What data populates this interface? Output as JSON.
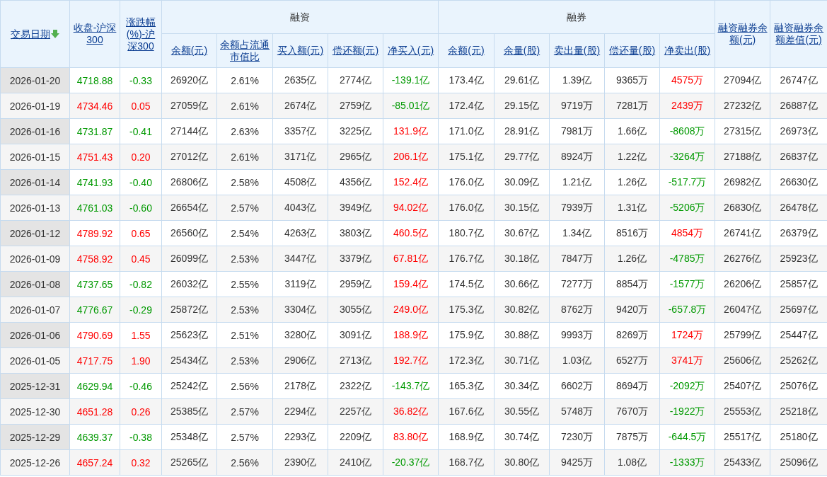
{
  "table": {
    "header": {
      "date": "交易日期",
      "date_sorted": true,
      "close": "收盘-沪深300",
      "change": "涨跌幅(%)-沪深300",
      "financing_group": "融资",
      "securities_group": "融券",
      "financing_columns": [
        "余额(元)",
        "余额占流通市值比",
        "买入额(元)",
        "偿还额(元)",
        "净买入(元)"
      ],
      "securities_columns": [
        "余额(元)",
        "余量(股)",
        "卖出量(股)",
        "偿还量(股)",
        "净卖出(股)"
      ],
      "total_balance": "融资融券余额(元)",
      "balance_diff": "融资融券余额差值(元)"
    },
    "rows": [
      {
        "date": "2026-01-20",
        "close": {
          "text": "4718.88",
          "color": "#009900"
        },
        "change": {
          "text": "-0.33",
          "color": "#009900"
        },
        "fin_balance": "26920亿",
        "fin_ratio": "2.61%",
        "fin_buy": "2635亿",
        "fin_repay": "2774亿",
        "fin_net_buy": {
          "text": "-139.1亿",
          "color": "#009900"
        },
        "sec_balance": "173.4亿",
        "sec_volume": "29.61亿",
        "sec_sell": "1.39亿",
        "sec_repay": "9365万",
        "sec_net_sell": {
          "text": "4575万",
          "color": "#ff0000"
        },
        "total_balance": "27094亿",
        "balance_diff": "26747亿"
      },
      {
        "date": "2026-01-19",
        "close": {
          "text": "4734.46",
          "color": "#ff0000"
        },
        "change": {
          "text": "0.05",
          "color": "#ff0000"
        },
        "fin_balance": "27059亿",
        "fin_ratio": "2.61%",
        "fin_buy": "2674亿",
        "fin_repay": "2759亿",
        "fin_net_buy": {
          "text": "-85.01亿",
          "color": "#009900"
        },
        "sec_balance": "172.4亿",
        "sec_volume": "29.15亿",
        "sec_sell": "9719万",
        "sec_repay": "7281万",
        "sec_net_sell": {
          "text": "2439万",
          "color": "#ff0000"
        },
        "total_balance": "27232亿",
        "balance_diff": "26887亿"
      },
      {
        "date": "2026-01-16",
        "close": {
          "text": "4731.87",
          "color": "#009900"
        },
        "change": {
          "text": "-0.41",
          "color": "#009900"
        },
        "fin_balance": "27144亿",
        "fin_ratio": "2.63%",
        "fin_buy": "3357亿",
        "fin_repay": "3225亿",
        "fin_net_buy": {
          "text": "131.9亿",
          "color": "#ff0000"
        },
        "sec_balance": "171.0亿",
        "sec_volume": "28.91亿",
        "sec_sell": "7981万",
        "sec_repay": "1.66亿",
        "sec_net_sell": {
          "text": "-8608万",
          "color": "#009900"
        },
        "total_balance": "27315亿",
        "balance_diff": "26973亿"
      },
      {
        "date": "2026-01-15",
        "close": {
          "text": "4751.43",
          "color": "#ff0000"
        },
        "change": {
          "text": "0.20",
          "color": "#ff0000"
        },
        "fin_balance": "27012亿",
        "fin_ratio": "2.61%",
        "fin_buy": "3171亿",
        "fin_repay": "2965亿",
        "fin_net_buy": {
          "text": "206.1亿",
          "color": "#ff0000"
        },
        "sec_balance": "175.1亿",
        "sec_volume": "29.77亿",
        "sec_sell": "8924万",
        "sec_repay": "1.22亿",
        "sec_net_sell": {
          "text": "-3264万",
          "color": "#009900"
        },
        "total_balance": "27188亿",
        "balance_diff": "26837亿"
      },
      {
        "date": "2026-01-14",
        "close": {
          "text": "4741.93",
          "color": "#009900"
        },
        "change": {
          "text": "-0.40",
          "color": "#009900"
        },
        "fin_balance": "26806亿",
        "fin_ratio": "2.58%",
        "fin_buy": "4508亿",
        "fin_repay": "4356亿",
        "fin_net_buy": {
          "text": "152.4亿",
          "color": "#ff0000"
        },
        "sec_balance": "176.0亿",
        "sec_volume": "30.09亿",
        "sec_sell": "1.21亿",
        "sec_repay": "1.26亿",
        "sec_net_sell": {
          "text": "-517.7万",
          "color": "#009900"
        },
        "total_balance": "26982亿",
        "balance_diff": "26630亿"
      },
      {
        "date": "2026-01-13",
        "close": {
          "text": "4761.03",
          "color": "#009900"
        },
        "change": {
          "text": "-0.60",
          "color": "#009900"
        },
        "fin_balance": "26654亿",
        "fin_ratio": "2.57%",
        "fin_buy": "4043亿",
        "fin_repay": "3949亿",
        "fin_net_buy": {
          "text": "94.02亿",
          "color": "#ff0000"
        },
        "sec_balance": "176.0亿",
        "sec_volume": "30.15亿",
        "sec_sell": "7939万",
        "sec_repay": "1.31亿",
        "sec_net_sell": {
          "text": "-5206万",
          "color": "#009900"
        },
        "total_balance": "26830亿",
        "balance_diff": "26478亿"
      },
      {
        "date": "2026-01-12",
        "close": {
          "text": "4789.92",
          "color": "#ff0000"
        },
        "change": {
          "text": "0.65",
          "color": "#ff0000"
        },
        "fin_balance": "26560亿",
        "fin_ratio": "2.54%",
        "fin_buy": "4263亿",
        "fin_repay": "3803亿",
        "fin_net_buy": {
          "text": "460.5亿",
          "color": "#ff0000"
        },
        "sec_balance": "180.7亿",
        "sec_volume": "30.67亿",
        "sec_sell": "1.34亿",
        "sec_repay": "8516万",
        "sec_net_sell": {
          "text": "4854万",
          "color": "#ff0000"
        },
        "total_balance": "26741亿",
        "balance_diff": "26379亿"
      },
      {
        "date": "2026-01-09",
        "close": {
          "text": "4758.92",
          "color": "#ff0000"
        },
        "change": {
          "text": "0.45",
          "color": "#ff0000"
        },
        "fin_balance": "26099亿",
        "fin_ratio": "2.53%",
        "fin_buy": "3447亿",
        "fin_repay": "3379亿",
        "fin_net_buy": {
          "text": "67.81亿",
          "color": "#ff0000"
        },
        "sec_balance": "176.7亿",
        "sec_volume": "30.18亿",
        "sec_sell": "7847万",
        "sec_repay": "1.26亿",
        "sec_net_sell": {
          "text": "-4785万",
          "color": "#009900"
        },
        "total_balance": "26276亿",
        "balance_diff": "25923亿"
      },
      {
        "date": "2026-01-08",
        "close": {
          "text": "4737.65",
          "color": "#009900"
        },
        "change": {
          "text": "-0.82",
          "color": "#009900"
        },
        "fin_balance": "26032亿",
        "fin_ratio": "2.55%",
        "fin_buy": "3119亿",
        "fin_repay": "2959亿",
        "fin_net_buy": {
          "text": "159.4亿",
          "color": "#ff0000"
        },
        "sec_balance": "174.5亿",
        "sec_volume": "30.66亿",
        "sec_sell": "7277万",
        "sec_repay": "8854万",
        "sec_net_sell": {
          "text": "-1577万",
          "color": "#009900"
        },
        "total_balance": "26206亿",
        "balance_diff": "25857亿"
      },
      {
        "date": "2026-01-07",
        "close": {
          "text": "4776.67",
          "color": "#009900"
        },
        "change": {
          "text": "-0.29",
          "color": "#009900"
        },
        "fin_balance": "25872亿",
        "fin_ratio": "2.53%",
        "fin_buy": "3304亿",
        "fin_repay": "3055亿",
        "fin_net_buy": {
          "text": "249.0亿",
          "color": "#ff0000"
        },
        "sec_balance": "175.3亿",
        "sec_volume": "30.82亿",
        "sec_sell": "8762万",
        "sec_repay": "9420万",
        "sec_net_sell": {
          "text": "-657.8万",
          "color": "#009900"
        },
        "total_balance": "26047亿",
        "balance_diff": "25697亿"
      },
      {
        "date": "2026-01-06",
        "close": {
          "text": "4790.69",
          "color": "#ff0000"
        },
        "change": {
          "text": "1.55",
          "color": "#ff0000"
        },
        "fin_balance": "25623亿",
        "fin_ratio": "2.51%",
        "fin_buy": "3280亿",
        "fin_repay": "3091亿",
        "fin_net_buy": {
          "text": "188.9亿",
          "color": "#ff0000"
        },
        "sec_balance": "175.9亿",
        "sec_volume": "30.88亿",
        "sec_sell": "9993万",
        "sec_repay": "8269万",
        "sec_net_sell": {
          "text": "1724万",
          "color": "#ff0000"
        },
        "total_balance": "25799亿",
        "balance_diff": "25447亿"
      },
      {
        "date": "2026-01-05",
        "close": {
          "text": "4717.75",
          "color": "#ff0000"
        },
        "change": {
          "text": "1.90",
          "color": "#ff0000"
        },
        "fin_balance": "25434亿",
        "fin_ratio": "2.53%",
        "fin_buy": "2906亿",
        "fin_repay": "2713亿",
        "fin_net_buy": {
          "text": "192.7亿",
          "color": "#ff0000"
        },
        "sec_balance": "172.3亿",
        "sec_volume": "30.71亿",
        "sec_sell": "1.03亿",
        "sec_repay": "6527万",
        "sec_net_sell": {
          "text": "3741万",
          "color": "#ff0000"
        },
        "total_balance": "25606亿",
        "balance_diff": "25262亿"
      },
      {
        "date": "2025-12-31",
        "close": {
          "text": "4629.94",
          "color": "#009900"
        },
        "change": {
          "text": "-0.46",
          "color": "#009900"
        },
        "fin_balance": "25242亿",
        "fin_ratio": "2.56%",
        "fin_buy": "2178亿",
        "fin_repay": "2322亿",
        "fin_net_buy": {
          "text": "-143.7亿",
          "color": "#009900"
        },
        "sec_balance": "165.3亿",
        "sec_volume": "30.34亿",
        "sec_sell": "6602万",
        "sec_repay": "8694万",
        "sec_net_sell": {
          "text": "-2092万",
          "color": "#009900"
        },
        "total_balance": "25407亿",
        "balance_diff": "25076亿"
      },
      {
        "date": "2025-12-30",
        "close": {
          "text": "4651.28",
          "color": "#ff0000"
        },
        "change": {
          "text": "0.26",
          "color": "#ff0000"
        },
        "fin_balance": "25385亿",
        "fin_ratio": "2.57%",
        "fin_buy": "2294亿",
        "fin_repay": "2257亿",
        "fin_net_buy": {
          "text": "36.82亿",
          "color": "#ff0000"
        },
        "sec_balance": "167.6亿",
        "sec_volume": "30.55亿",
        "sec_sell": "5748万",
        "sec_repay": "7670万",
        "sec_net_sell": {
          "text": "-1922万",
          "color": "#009900"
        },
        "total_balance": "25553亿",
        "balance_diff": "25218亿"
      },
      {
        "date": "2025-12-29",
        "close": {
          "text": "4639.37",
          "color": "#009900"
        },
        "change": {
          "text": "-0.38",
          "color": "#009900"
        },
        "fin_balance": "25348亿",
        "fin_ratio": "2.57%",
        "fin_buy": "2293亿",
        "fin_repay": "2209亿",
        "fin_net_buy": {
          "text": "83.80亿",
          "color": "#ff0000"
        },
        "sec_balance": "168.9亿",
        "sec_volume": "30.74亿",
        "sec_sell": "7230万",
        "sec_repay": "7875万",
        "sec_net_sell": {
          "text": "-644.5万",
          "color": "#009900"
        },
        "total_balance": "25517亿",
        "balance_diff": "25180亿"
      },
      {
        "date": "2025-12-26",
        "close": {
          "text": "4657.24",
          "color": "#ff0000"
        },
        "change": {
          "text": "0.32",
          "color": "#ff0000"
        },
        "fin_balance": "25265亿",
        "fin_ratio": "2.56%",
        "fin_buy": "2390亿",
        "fin_repay": "2410亿",
        "fin_net_buy": {
          "text": "-20.37亿",
          "color": "#009900"
        },
        "sec_balance": "168.7亿",
        "sec_volume": "30.80亿",
        "sec_sell": "9425万",
        "sec_repay": "1.08亿",
        "sec_net_sell": {
          "text": "-1333万",
          "color": "#009900"
        },
        "total_balance": "25433亿",
        "balance_diff": "25096亿"
      }
    ]
  }
}
